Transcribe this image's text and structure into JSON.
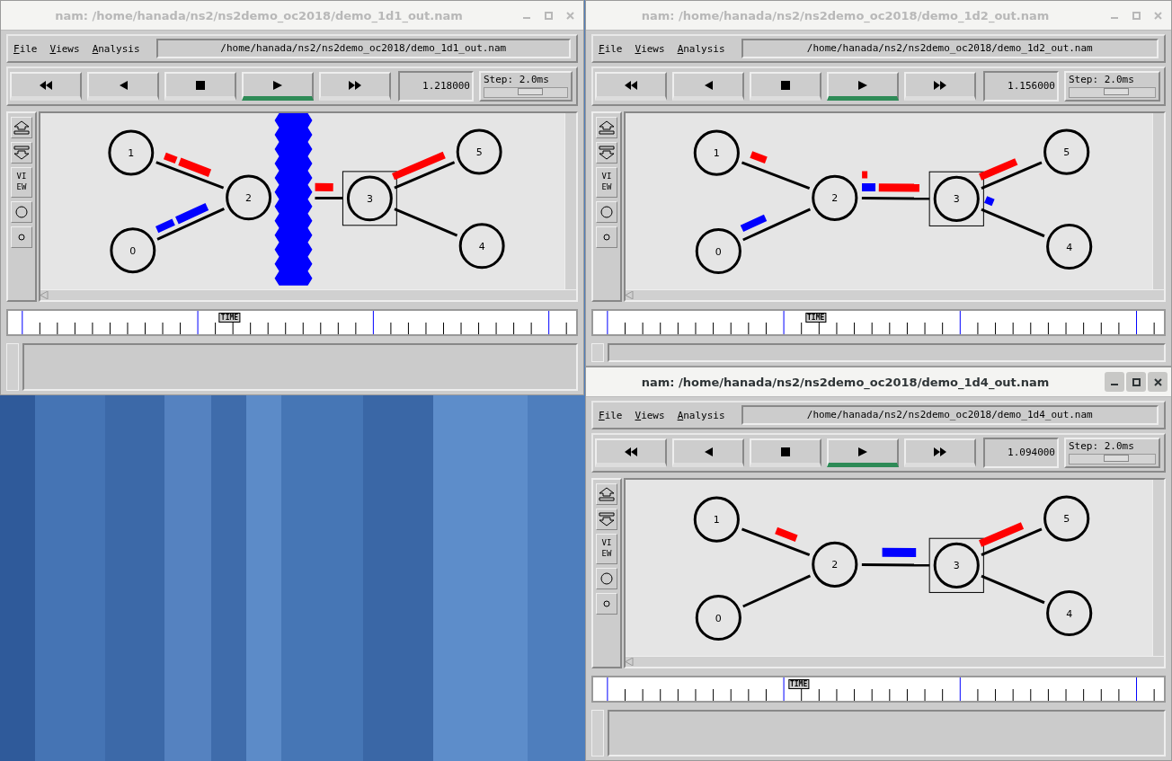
{
  "windows": [
    {
      "title": "nam: /home/hanada/ns2/ns2demo_oc2018/demo_1d1_out.nam",
      "active": false,
      "menu": [
        "File",
        "Views",
        "Analysis"
      ],
      "file_path": "/home/hanada/ns2/ns2demo_oc2018/demo_1d1_out.nam",
      "buttons": [
        {
          "kind": "rewind",
          "selected": false
        },
        {
          "kind": "back",
          "selected": false
        },
        {
          "kind": "stop",
          "selected": false
        },
        {
          "kind": "play",
          "selected": true
        },
        {
          "kind": "forward",
          "selected": false
        }
      ],
      "time": "1.218000",
      "step": {
        "label": "Step: 2.0ms",
        "level": 0.55
      },
      "view_label": "VIEW",
      "nodes": [
        {
          "label": "0",
          "kind": "circle"
        },
        {
          "label": "1",
          "kind": "circle"
        },
        {
          "label": "2",
          "kind": "circle"
        },
        {
          "label": "3",
          "kind": "boxed"
        },
        {
          "label": "4",
          "kind": "circle"
        },
        {
          "label": "5",
          "kind": "circle"
        }
      ],
      "timeline": {
        "marker_label": "TIME",
        "level": 0.39
      }
    },
    {
      "title": "nam: /home/hanada/ns2/ns2demo_oc2018/demo_1d2_out.nam",
      "active": false,
      "menu": [
        "File",
        "Views",
        "Analysis"
      ],
      "file_path": "/home/hanada/ns2/ns2demo_oc2018/demo_1d2_out.nam",
      "buttons": [
        {
          "kind": "rewind",
          "selected": false
        },
        {
          "kind": "back",
          "selected": false
        },
        {
          "kind": "stop",
          "selected": false
        },
        {
          "kind": "play",
          "selected": true
        },
        {
          "kind": "forward",
          "selected": false
        }
      ],
      "time": "1.156000",
      "step": {
        "label": "Step: 2.0ms",
        "level": 0.55
      },
      "view_label": "VIEW",
      "nodes": [
        {
          "label": "0",
          "kind": "circle"
        },
        {
          "label": "1",
          "kind": "circle"
        },
        {
          "label": "2",
          "kind": "circle"
        },
        {
          "label": "3",
          "kind": "boxed"
        },
        {
          "label": "4",
          "kind": "circle"
        },
        {
          "label": "5",
          "kind": "circle"
        }
      ],
      "timeline": {
        "marker_label": "TIME",
        "level": 0.39
      }
    },
    {
      "title": "nam: /home/hanada/ns2/ns2demo_oc2018/demo_1d4_out.nam",
      "active": true,
      "menu": [
        "File",
        "Views",
        "Analysis"
      ],
      "file_path": "/home/hanada/ns2/ns2demo_oc2018/demo_1d4_out.nam",
      "buttons": [
        {
          "kind": "rewind",
          "selected": false
        },
        {
          "kind": "back",
          "selected": false
        },
        {
          "kind": "stop",
          "selected": false
        },
        {
          "kind": "play",
          "selected": true
        },
        {
          "kind": "forward",
          "selected": false
        }
      ],
      "time": "1.094000",
      "step": {
        "label": "Step: 2.0ms",
        "level": 0.55
      },
      "view_label": "VIEW",
      "nodes": [
        {
          "label": "0",
          "kind": "circle"
        },
        {
          "label": "1",
          "kind": "circle"
        },
        {
          "label": "2",
          "kind": "circle"
        },
        {
          "label": "3",
          "kind": "boxed"
        },
        {
          "label": "4",
          "kind": "circle"
        },
        {
          "label": "5",
          "kind": "circle"
        }
      ],
      "timeline": {
        "marker_label": "TIME",
        "level": 0.36
      }
    }
  ]
}
